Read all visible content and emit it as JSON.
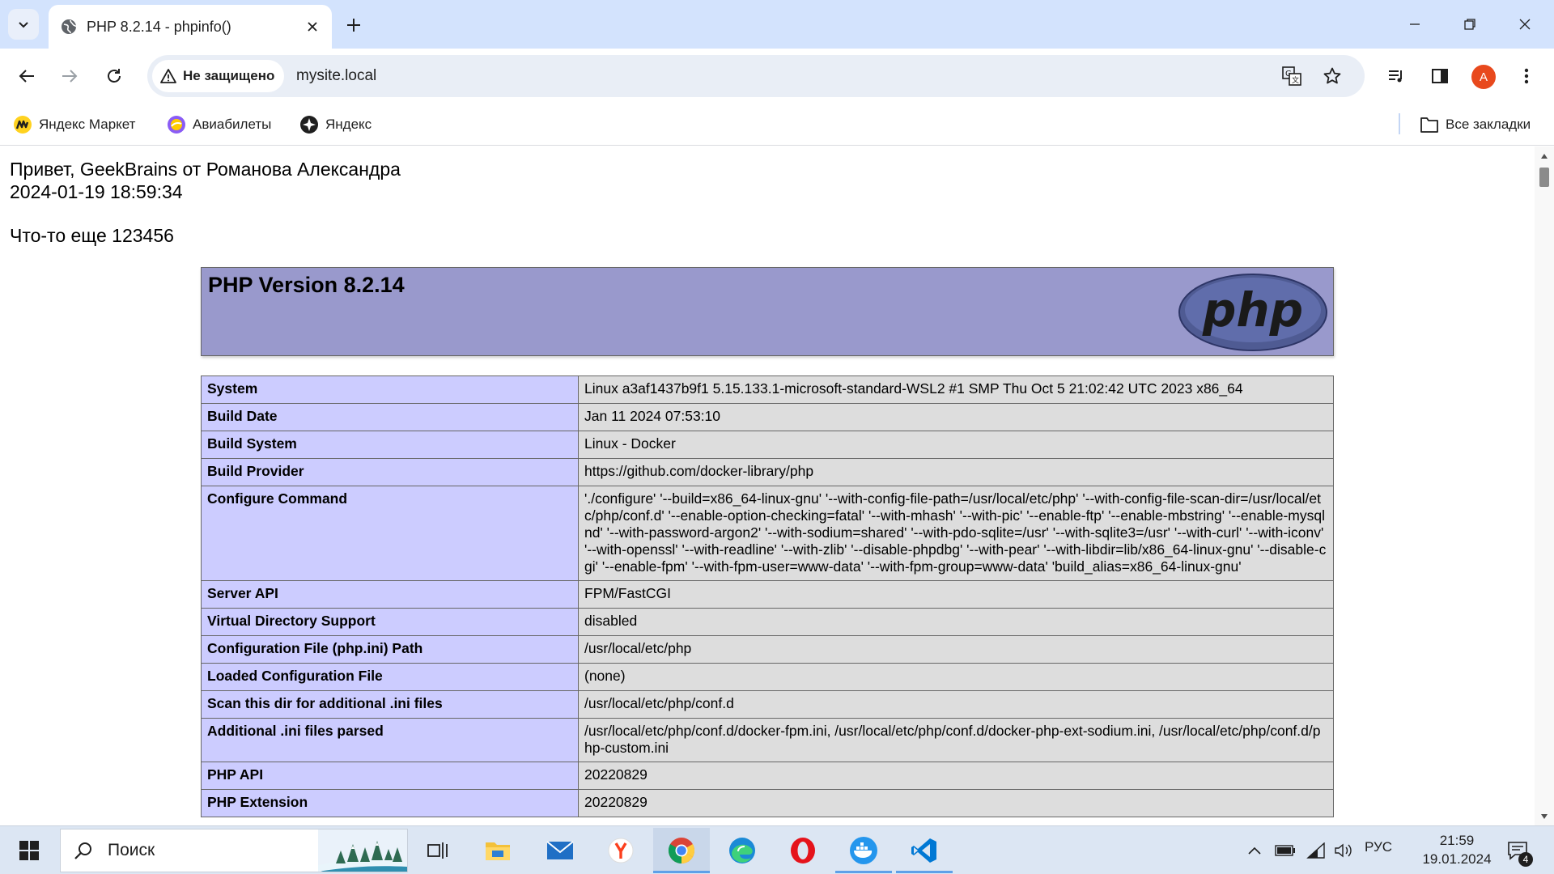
{
  "browser": {
    "tab": {
      "title": "PHP 8.2.14 - phpinfo()"
    },
    "address_bar": {
      "security_label": "Не защищено",
      "url": "mysite.local"
    },
    "profile_initial": "A",
    "bookmarks": [
      {
        "label": "Яндекс Маркет",
        "icon": "yandex-market-icon"
      },
      {
        "label": "Авиабилеты",
        "icon": "aviabilety-icon"
      },
      {
        "label": "Яндекс",
        "icon": "yandex-icon"
      }
    ],
    "all_bookmarks_label": "Все закладки"
  },
  "page": {
    "greeting_lines": [
      "Привет, GeekBrains от Романова Александра",
      "2024-01-19 18:59:34"
    ],
    "extra_line": "Что-то еще 123456",
    "php_header": {
      "version_title": "PHP Version 8.2.14",
      "logo_text": "php"
    },
    "info_rows": [
      {
        "key": "System",
        "value": "Linux a3af1437b9f1 5.15.133.1-microsoft-standard-WSL2 #1 SMP Thu Oct 5 21:02:42 UTC 2023 x86_64"
      },
      {
        "key": "Build Date",
        "value": "Jan 11 2024 07:53:10"
      },
      {
        "key": "Build System",
        "value": "Linux - Docker"
      },
      {
        "key": "Build Provider",
        "value": "https://github.com/docker-library/php"
      },
      {
        "key": "Configure Command",
        "value": "'./configure' '--build=x86_64-linux-gnu' '--with-config-file-path=/usr/local/etc/php' '--with-config-file-scan-dir=/usr/local/etc/php/conf.d' '--enable-option-checking=fatal' '--with-mhash' '--with-pic' '--enable-ftp' '--enable-mbstring' '--enable-mysqlnd' '--with-password-argon2' '--with-sodium=shared' '--with-pdo-sqlite=/usr' '--with-sqlite3=/usr' '--with-curl' '--with-iconv' '--with-openssl' '--with-readline' '--with-zlib' '--disable-phpdbg' '--with-pear' '--with-libdir=lib/x86_64-linux-gnu' '--disable-cgi' '--enable-fpm' '--with-fpm-user=www-data' '--with-fpm-group=www-data' 'build_alias=x86_64-linux-gnu'"
      },
      {
        "key": "Server API",
        "value": "FPM/FastCGI"
      },
      {
        "key": "Virtual Directory Support",
        "value": "disabled"
      },
      {
        "key": "Configuration File (php.ini) Path",
        "value": "/usr/local/etc/php"
      },
      {
        "key": "Loaded Configuration File",
        "value": "(none)"
      },
      {
        "key": "Scan this dir for additional .ini files",
        "value": "/usr/local/etc/php/conf.d"
      },
      {
        "key": "Additional .ini files parsed",
        "value": "/usr/local/etc/php/conf.d/docker-fpm.ini, /usr/local/etc/php/conf.d/docker-php-ext-sodium.ini, /usr/local/etc/php/conf.d/php-custom.ini"
      },
      {
        "key": "PHP API",
        "value": "20220829"
      },
      {
        "key": "PHP Extension",
        "value": "20220829"
      }
    ]
  },
  "taskbar": {
    "search_label": "Поиск",
    "apps": [
      "task-view-icon",
      "file-explorer-icon",
      "mail-icon",
      "yandex-browser-icon",
      "chrome-icon",
      "edge-icon",
      "opera-icon",
      "docker-icon",
      "vscode-icon"
    ],
    "language": "РУС",
    "time": "21:59",
    "date": "19.01.2024",
    "notification_count": "4"
  },
  "colors": {
    "tab_strip": "#d3e3fd",
    "php_header_bg": "#9999cc",
    "php_key_bg": "#ccccff",
    "php_value_bg": "#dddddd",
    "taskbar_bg": "#dce6f3"
  }
}
